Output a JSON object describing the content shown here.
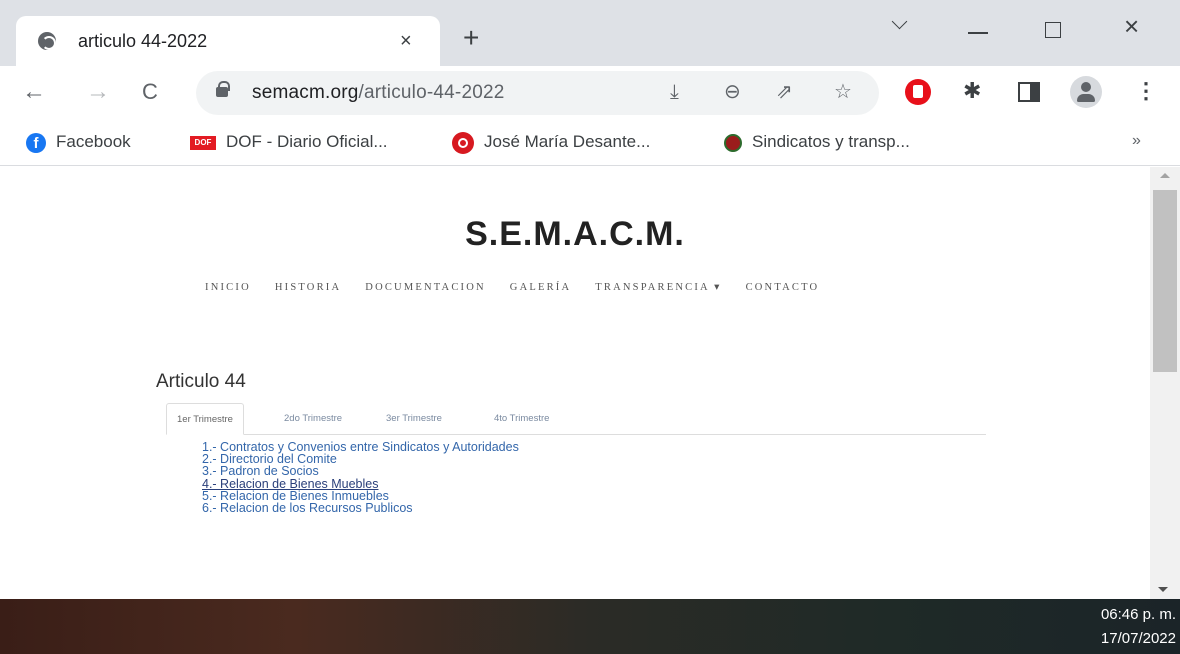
{
  "browser": {
    "tab": {
      "title": "articulo 44-2022",
      "close": "×",
      "new_tab": "+"
    },
    "window_controls": {
      "close": "×"
    },
    "toolbar": {
      "back": "←",
      "forward": "→",
      "reload": "C",
      "url_domain": "semacm.org",
      "url_path": "/articulo-44-2022",
      "icons": [
        "install-app-icon",
        "zoom-icon",
        "share-icon",
        "bookmark-star-icon",
        "adblock-stop-icon",
        "extensions-icon",
        "side-panel-icon",
        "profile-icon",
        "menu-icon"
      ]
    },
    "bookmarks": [
      {
        "label": "Facebook",
        "icon": "facebook-icon"
      },
      {
        "label": "DOF - Diario Oficial...",
        "icon": "dof-icon"
      },
      {
        "label": "José María Desante...",
        "icon": "record-icon"
      },
      {
        "label": "Sindicatos y transp...",
        "icon": "sindicatos-icon"
      }
    ],
    "bookmarks_more": "»",
    "colors": {
      "tabstrip": "#dee1e6",
      "omnibox": "#f1f3f4"
    }
  },
  "site": {
    "title": "S.E.M.A.C.M.",
    "nav": [
      "INICIO",
      "HISTORIA",
      "DOCUMENTACION",
      "GALERÍA",
      "TRANSPARENCIA ▾",
      "CONTACTO"
    ],
    "heading": "Articulo 44",
    "tabs": [
      "1er Trimestre",
      "2do Trimestre",
      "3er Trimestre",
      "4to Trimestre"
    ],
    "active_tab": "1er Trimestre",
    "documents": [
      "1.- Contratos y Convenios entre Sindicatos y Autoridades",
      "2.- Directorio del Comite",
      "3.- Padron de Socios",
      "4.- Relacion de Bienes Muebles",
      "5.- Relacion de Bienes Inmuebles",
      "6.- Relacion de los Recursos Publicos"
    ],
    "colors": {
      "link": "#3366aa",
      "link_hover": "#2a3f7a"
    }
  },
  "taskbar": {
    "time": "06:46 p. m.",
    "date": "17/07/2022"
  }
}
